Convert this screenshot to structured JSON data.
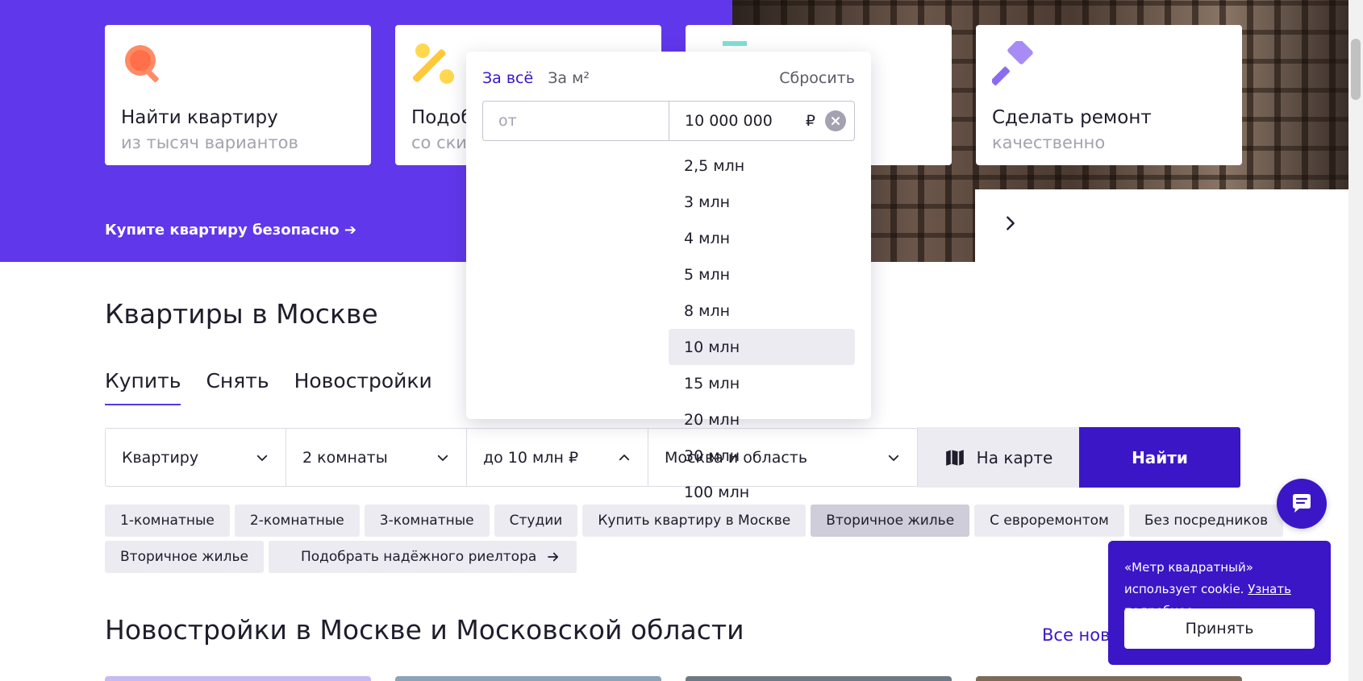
{
  "hero": {
    "cards": [
      {
        "icon": "magnifier-icon",
        "title": "Найти квартиру",
        "subtitle": "из тысяч вариантов"
      },
      {
        "icon": "percent-icon",
        "title": "Подоб",
        "subtitle": "со ски"
      },
      {
        "icon": "card-icon",
        "title": "",
        "subtitle": ""
      },
      {
        "icon": "paint-roller-icon",
        "title": "Сделать ремонт",
        "subtitle": "качественно"
      }
    ],
    "safe_link": "Купите квартиру безопасно ➔",
    "carousel_next_icon": "chevron-right-icon"
  },
  "section": {
    "title": "Квартиры в Москве",
    "tabs": [
      "Купить",
      "Снять",
      "Новостройки"
    ],
    "active_tab": "Купить"
  },
  "search": {
    "type": "Квартиру",
    "rooms": "2 комнаты",
    "price": "до 10 млн ₽",
    "location": "Москва и область",
    "map_button": "На карте",
    "find_button": "Найти"
  },
  "chips": {
    "row1": [
      "1-комнатные",
      "2-комнатные",
      "3-комнатные",
      "Студии",
      "Купить квартиру в Москве",
      "Вторичное жилье",
      "С евроремонтом",
      "Без посредников"
    ],
    "row1_selected": "Вторичное жилье",
    "row2": [
      "Вторичное жилье",
      "Подобрать надёжного риелтора"
    ]
  },
  "price_dropdown": {
    "tabs": [
      "За всё",
      "За м²"
    ],
    "active_tab": "За всё",
    "reset": "Сбросить",
    "from_placeholder": "от",
    "to_value": "10 000 000",
    "currency": "₽",
    "options": [
      "2,5 млн",
      "3 млн",
      "4 млн",
      "5 млн",
      "8 млн",
      "10 млн",
      "15 млн",
      "20 млн",
      "30 млн",
      "100 млн"
    ],
    "selected_option": "10 млн"
  },
  "new_buildings": {
    "title": "Новостройки в Москве и Московской области",
    "all_link": "Все ново"
  },
  "cookie": {
    "text": "«Метр квадратный» использует cookie.",
    "link": "Узнать подробнее",
    "after_link": ".",
    "accept": "Принять"
  },
  "colors": {
    "brand": "#3b16c7",
    "hero": "#6137eb",
    "chip": "#ecebf2",
    "chip_selected": "#cfcdda"
  }
}
